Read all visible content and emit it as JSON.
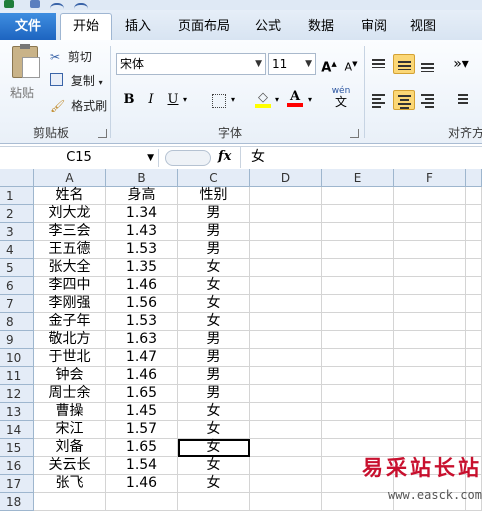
{
  "qat_icons": [
    "excel-logo-icon",
    "save-icon",
    "undo-icon",
    "redo-icon"
  ],
  "tabs": [
    {
      "label": "文件",
      "name": "tab-file"
    },
    {
      "label": "开始",
      "name": "tab-home"
    },
    {
      "label": "插入",
      "name": "tab-insert"
    },
    {
      "label": "页面布局",
      "name": "tab-page-layout"
    },
    {
      "label": "公式",
      "name": "tab-formulas"
    },
    {
      "label": "数据",
      "name": "tab-data"
    },
    {
      "label": "审阅",
      "name": "tab-review"
    },
    {
      "label": "视图",
      "name": "tab-view"
    }
  ],
  "clipboard": {
    "paste": "粘贴",
    "cut": "剪切",
    "copy": "复制",
    "format_painter": "格式刷",
    "group": "剪贴板"
  },
  "font": {
    "name": "宋体",
    "size": "11",
    "group": "字体",
    "grow": "A",
    "shrink": "A",
    "bold": "B",
    "italic": "I",
    "underline": "U",
    "color_letter": "A",
    "wen": "wén",
    "wen_char": "文"
  },
  "alignment": {
    "group": "对齐方"
  },
  "colors": {
    "accent": "#1d64c0",
    "highlight": "#fbd776",
    "fill_yellow": "#ffff00",
    "font_red": "#ff0000",
    "header_bg": "#e4ecf7"
  },
  "formula_bar": {
    "cell_ref": "C15",
    "fx": "fx",
    "value": "女"
  },
  "columns": [
    "A",
    "B",
    "C",
    "D",
    "E",
    "F"
  ],
  "rows": [
    [
      "姓名",
      "身高",
      "性别"
    ],
    [
      "刘大龙",
      "1.34",
      "男"
    ],
    [
      "李三会",
      "1.43",
      "男"
    ],
    [
      "王五德",
      "1.53",
      "男"
    ],
    [
      "张大全",
      "1.35",
      "女"
    ],
    [
      "李四中",
      "1.46",
      "女"
    ],
    [
      "李刚强",
      "1.56",
      "女"
    ],
    [
      "金子年",
      "1.53",
      "女"
    ],
    [
      "敬北方",
      "1.63",
      "男"
    ],
    [
      "于世北",
      "1.47",
      "男"
    ],
    [
      "钟会",
      "1.46",
      "男"
    ],
    [
      "周士余",
      "1.65",
      "男"
    ],
    [
      "曹操",
      "1.45",
      "女"
    ],
    [
      "宋江",
      "1.57",
      "女"
    ],
    [
      "刘备",
      "1.65",
      "女"
    ],
    [
      "关云长",
      "1.54",
      "女"
    ],
    [
      "张飞",
      "1.46",
      "女"
    ],
    [
      "",
      "",
      " "
    ]
  ],
  "row_numbers": [
    "1",
    "2",
    "3",
    "4",
    "5",
    "6",
    "7",
    "8",
    "9",
    "10",
    "11",
    "12",
    "13",
    "14",
    "15",
    "16",
    "17",
    "18"
  ],
  "selected_cell": {
    "row": 15,
    "col": 3
  },
  "watermark": {
    "title": "易采站长站",
    "url": "www.easck.com"
  }
}
